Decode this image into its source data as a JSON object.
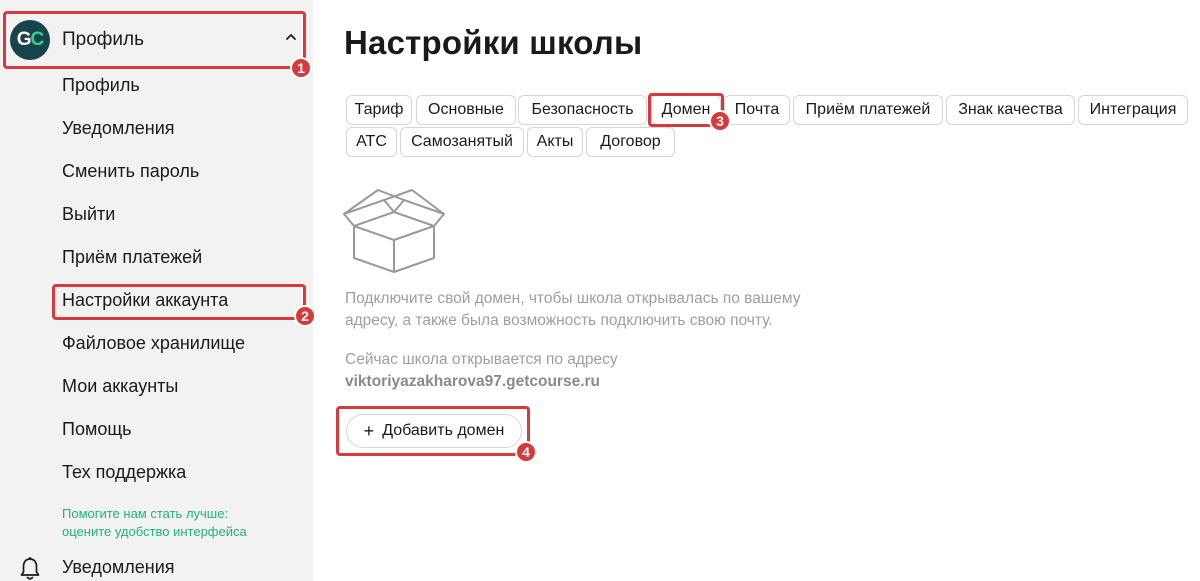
{
  "sidebar": {
    "avatar": {
      "g": "G",
      "c": "C"
    },
    "profile_label": "Профиль",
    "items": [
      {
        "label": "Профиль"
      },
      {
        "label": "Уведомления"
      },
      {
        "label": "Сменить пароль"
      },
      {
        "label": "Выйти"
      },
      {
        "label": "Приём платежей"
      },
      {
        "label": "Настройки аккаунта"
      },
      {
        "label": "Файловое хранилище"
      },
      {
        "label": "Мои аккаунты"
      },
      {
        "label": "Помощь"
      },
      {
        "label": "Тех поддержка"
      }
    ],
    "feedback_line1": "Помогите нам стать лучше:",
    "feedback_line2": "оцените удобство интерфейса",
    "bottom_label": "Уведомления",
    "feedback_color": "#1fb471"
  },
  "main": {
    "title": "Настройки школы",
    "tabs": [
      {
        "label": "Тариф"
      },
      {
        "label": "Основные"
      },
      {
        "label": "Безопасность"
      },
      {
        "label": "Домен"
      },
      {
        "label": "Почта"
      },
      {
        "label": "Приём платежей"
      },
      {
        "label": "Знак качества"
      },
      {
        "label": "Интеграция"
      },
      {
        "label": "АТС"
      },
      {
        "label": "Самозанятый"
      },
      {
        "label": "Акты"
      },
      {
        "label": "Договор"
      }
    ],
    "empty_icon": "box-icon",
    "info_line1": "Подключите свой домен, чтобы школа открывалась по вашему",
    "info_line2": "адресу, а также была возможность подключить свою почту.",
    "current_line": "Сейчас школа открывается по адресу",
    "current_domain": "viktoriyazakharova97.getcourse.ru",
    "add_button": {
      "plus": "+",
      "label": "Добавить домен"
    }
  },
  "annotations": {
    "color": "#d63a3a",
    "badges": [
      "1",
      "2",
      "3",
      "4"
    ]
  }
}
